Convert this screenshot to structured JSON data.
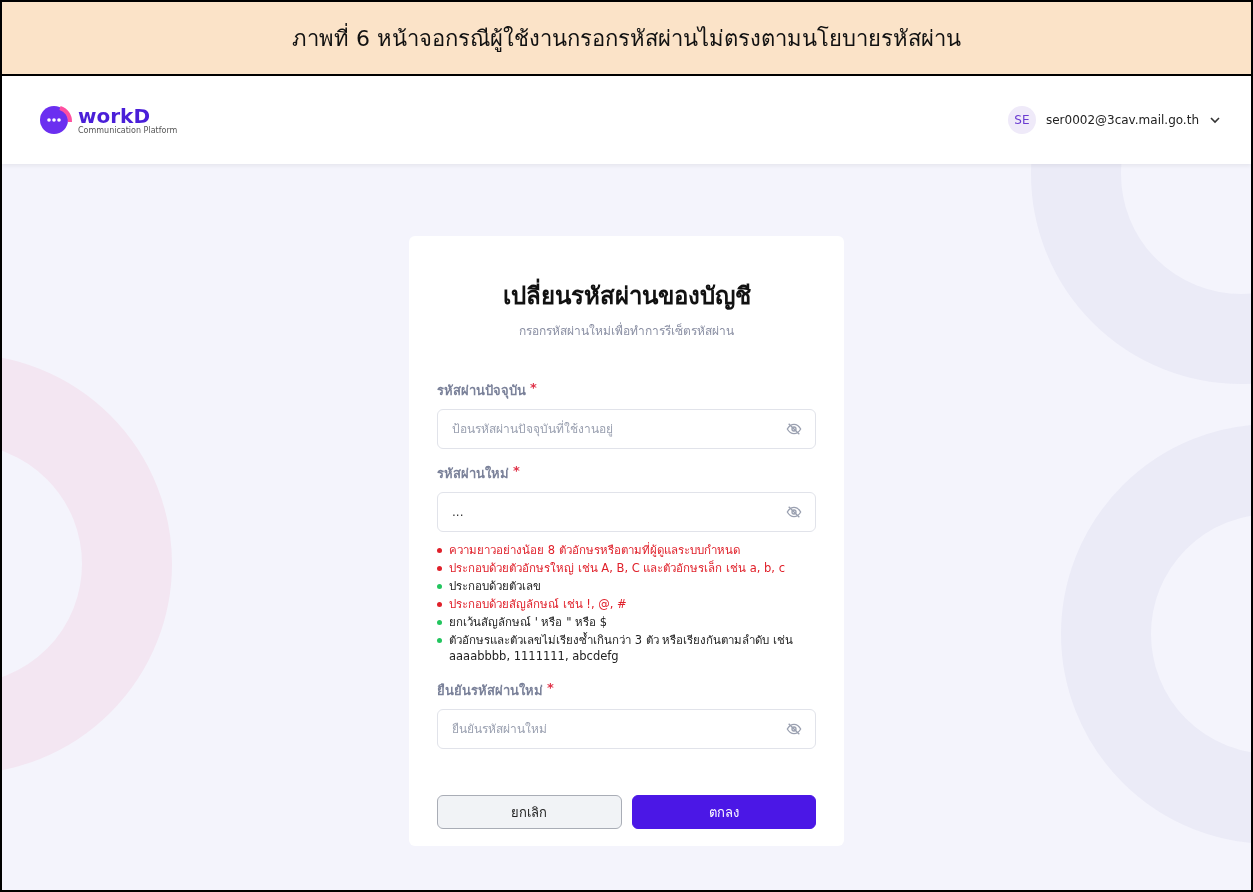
{
  "caption": "ภาพที่ 6 หน้าจอกรณีผู้ใช้งานกรอกรหัสผ่านไม่ตรงตามนโยบายรหัสผ่าน",
  "header": {
    "logo": {
      "name": "workD",
      "tagline": "Communication Platform"
    },
    "user": {
      "initials": "SE",
      "email": "ser0002@3cav.mail.go.th"
    }
  },
  "form": {
    "title": "เปลี่ยนรหัสผ่านของบัญชี",
    "subtitle": "กรอกรหัสผ่านใหม่เพื่อทำการรีเซ็ตรหัสผ่าน",
    "fields": [
      {
        "label": "รหัสผ่านปัจจุบัน",
        "required_mark": "*",
        "placeholder": "ป้อนรหัสผ่านปัจจุบันที่ใช้งานอยู่"
      },
      {
        "label": "รหัสผ่านใหม่",
        "required_mark": "*",
        "value": "...",
        "rules": [
          {
            "text": "ความยาวอย่างน้อย 8 ตัวอักษรหรือตามที่ผู้ดูแลระบบกำหนด",
            "met": false
          },
          {
            "text": "ประกอบด้วยตัวอักษรใหญ่ เช่น A, B, C และตัวอักษรเล็ก เช่น a, b, c",
            "met": false
          },
          {
            "text": "ประกอบด้วยตัวเลข",
            "met": true
          },
          {
            "text": "ประกอบด้วยสัญลักษณ์ เช่น !, @, #",
            "met": false
          },
          {
            "text": "ยกเว้นสัญลักษณ์ ' หรือ \" หรือ $",
            "met": true
          },
          {
            "text": "ตัวอักษรและตัวเลขไม่เรียงซ้ำเกินกว่า 3 ตัว หรือเรียงกันตามลำดับ เช่น aaaabbbb, 1111111, abcdefg",
            "met": true
          }
        ]
      },
      {
        "label": "ยืนยันรหัสผ่านใหม่",
        "required_mark": "*",
        "placeholder": "ยืนยันรหัสผ่านใหม่"
      }
    ],
    "buttons": [
      {
        "label": "ยกเลิก",
        "kind": "secondary"
      },
      {
        "label": "ตกลง",
        "kind": "primary"
      }
    ]
  }
}
